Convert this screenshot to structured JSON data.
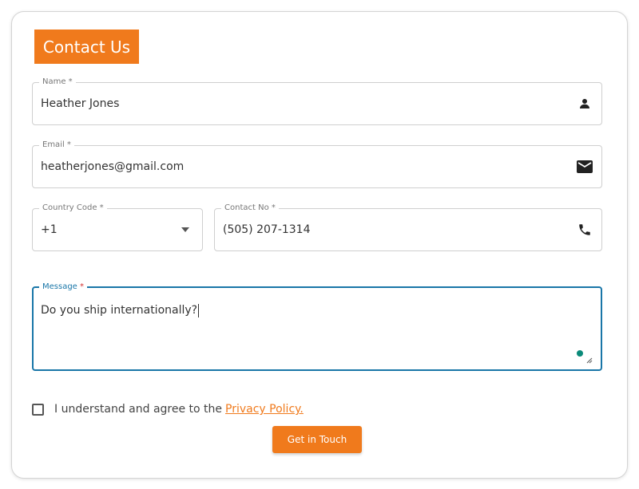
{
  "form": {
    "heading": "Contact Us",
    "name": {
      "label": "Name *",
      "value": "Heather Jones",
      "icon": "person-icon"
    },
    "email": {
      "label": "Email *",
      "value": "heatherjones@gmail.com",
      "icon": "mail-icon"
    },
    "country_code": {
      "label": "Country Code *",
      "value": "+1",
      "icon": "dropdown-arrow-icon"
    },
    "contact_no": {
      "label": "Contact No *",
      "value": "(505) 207-1314",
      "icon": "phone-icon"
    },
    "message": {
      "label": "Message",
      "required_mark": "*",
      "value": "Do you ship internationally?"
    },
    "agree": {
      "text": "I understand and agree to the",
      "link": "Privacy Policy.",
      "checked": false
    },
    "submit_label": "Get in Touch"
  },
  "colors": {
    "accent": "#f07a1c",
    "focus": "#1976a8",
    "required": "#d32f2f",
    "status_dot": "#0b8a7a"
  }
}
